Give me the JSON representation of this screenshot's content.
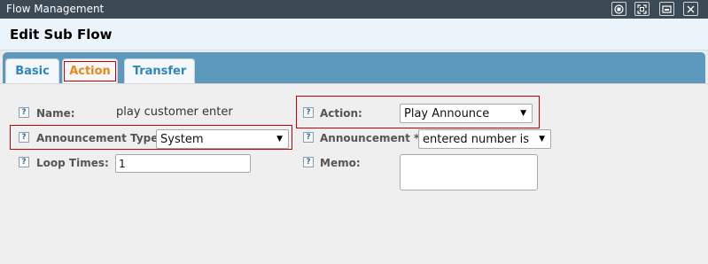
{
  "window": {
    "title": "Flow Management",
    "controls": [
      "restore-icon",
      "maximize-icon",
      "minimize-icon",
      "close-icon"
    ]
  },
  "header": {
    "title": "Edit Sub Flow"
  },
  "tabs": [
    {
      "label": "Basic",
      "active": false
    },
    {
      "label": "Action",
      "active": true
    },
    {
      "label": "Transfer",
      "active": false
    }
  ],
  "form": {
    "name": {
      "label": "Name:",
      "value": "play customer enter"
    },
    "action": {
      "label": "Action:",
      "value": "Play Announce"
    },
    "announcement_type": {
      "label": "Announcement Type:",
      "value": "System"
    },
    "announcement": {
      "label": "Announcement *:",
      "value": "entered number is"
    },
    "loop_times": {
      "label": "Loop Times:",
      "value": "1"
    },
    "memo": {
      "label": "Memo:",
      "value": ""
    }
  },
  "icons": {
    "help": "?"
  },
  "colors": {
    "tab_active": "#e58a1a",
    "tab_text": "#2f86bd",
    "tabbar": "#5d99bc",
    "highlight": "#c40000"
  }
}
